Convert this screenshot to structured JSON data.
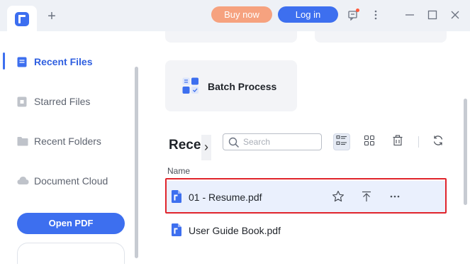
{
  "titlebar": {
    "new_tab_symbol": "+",
    "buy_label": "Buy now",
    "login_label": "Log in",
    "accent_color": "#3d6fef",
    "buy_color": "#f6a27f",
    "icons": [
      "feedback-icon",
      "more-vertical-icon",
      "minimize-icon",
      "maximize-icon",
      "close-icon"
    ]
  },
  "sidebar": {
    "items": [
      {
        "label": "Recent Files",
        "icon": "recent-files-icon",
        "active": true
      },
      {
        "label": "Starred Files",
        "icon": "star-file-icon",
        "active": false
      },
      {
        "label": "Recent Folders",
        "icon": "folder-icon",
        "active": false
      },
      {
        "label": "Document Cloud",
        "icon": "cloud-icon",
        "active": false
      }
    ],
    "open_pdf_label": "Open PDF"
  },
  "main": {
    "batch_label": "Batch Process",
    "recent_heading": "Recent",
    "search": {
      "placeholder": "Search",
      "value": ""
    },
    "column_name": "Name",
    "files": [
      {
        "name": "01 - Resume.pdf",
        "selected": true
      },
      {
        "name": "User Guide Book.pdf",
        "selected": false
      }
    ],
    "highlight_color": "#e0242c"
  }
}
